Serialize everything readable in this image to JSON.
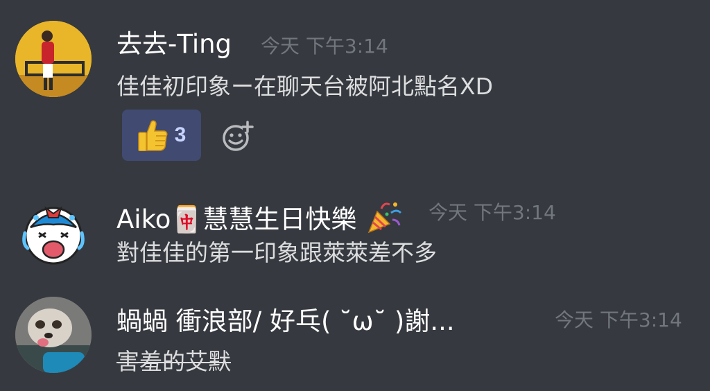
{
  "messages": [
    {
      "author": "去去-Ting",
      "timestamp": "今天 下午3:14",
      "text": "佳佳初印象ー在聊天台被阿北點名XD",
      "reaction": {
        "icon": "thumbs-up-icon",
        "count": "3"
      },
      "add_reaction_icon": "add-reaction-icon"
    },
    {
      "author": "Aiko🀄慧慧生日快樂",
      "author_emoji": "party-popper-icon",
      "timestamp": "今天 下午3:14",
      "text": "對佳佳的第一印象跟萊萊差不多"
    },
    {
      "author": "蝸蝸 衝浪部/ 好乓( ˘ω˘ )謝...",
      "timestamp": "今天 下午3:14",
      "text": "害羞的艾默"
    }
  ],
  "colors": {
    "background": "#36393f",
    "author": "#ffffff",
    "timestamp": "#72767d",
    "message_text": "#dcddde",
    "reaction_bg": "#414a70",
    "reaction_count": "#c8d3ff"
  }
}
